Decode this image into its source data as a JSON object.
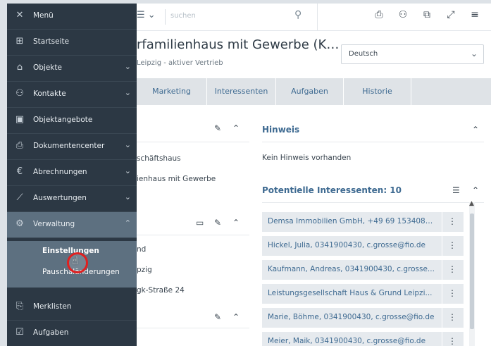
{
  "topbar": {
    "view_icon": "list-icon",
    "search_placeholder": "suchen",
    "icons": [
      "bookmark-icon",
      "user-icon",
      "copy-icon",
      "expand-icon",
      "menu-icon"
    ]
  },
  "header": {
    "title": "rfamilienhaus mit Gewerbe (K…",
    "subtitle": "Leipzig - aktiver Vertrieb",
    "language": "Deutsch"
  },
  "tabs": [
    "Marketing",
    "Interessenten",
    "Aufgaben",
    "Historie"
  ],
  "left_panel": {
    "lines_1": [
      "schäftshaus",
      "ienhaus mit Gewerbe"
    ],
    "lines_2": [
      "nd",
      "pzig",
      "gk-Straße 24"
    ]
  },
  "hint": {
    "heading": "Hinweis",
    "text": "Kein Hinweis vorhanden"
  },
  "prospects": {
    "heading": "Potentielle Interessenten: 10",
    "items": [
      "Demsa Immobilien GmbH, +49 69 1534080...",
      "Hickel, Julia, 0341900430, c.grosse@fio.de",
      "Kaufmann, Andreas, 0341900430, c.grosse...",
      "Leistungsgesellschaft Haus & Grund Leipzi...",
      "Marie, Böhme, 0341900430, c.grosse@fio.de",
      "Meier, Maik, 0341900430, c.grosse@fio.de"
    ]
  },
  "sidebar": {
    "header": "Menü",
    "items": [
      {
        "label": "Startseite",
        "icon": "grid-icon",
        "chevron": false
      },
      {
        "label": "Objekte",
        "icon": "home-icon",
        "chevron": true
      },
      {
        "label": "Kontakte",
        "icon": "user-icon",
        "chevron": true
      },
      {
        "label": "Objektangebote",
        "icon": "offer-icon",
        "chevron": false
      },
      {
        "label": "Dokumentencenter",
        "icon": "printer-icon",
        "chevron": true
      },
      {
        "label": "Abrechnungen",
        "icon": "euro-icon",
        "chevron": true
      },
      {
        "label": "Auswertungen",
        "icon": "chart-icon",
        "chevron": true
      },
      {
        "label": "Verwaltung",
        "icon": "gear-icon",
        "chevron": true,
        "expanded": true
      },
      {
        "label": "Merklisten",
        "icon": "bookmark-icon",
        "chevron": false
      },
      {
        "label": "Aufgaben",
        "icon": "tasks-icon",
        "chevron": false
      }
    ],
    "sub_items": [
      "Einstellungen",
      "Pauschaländerungen"
    ]
  },
  "colors": {
    "sidebar_bg": "#2c3844",
    "sidebar_active": "#5d7080",
    "accent": "#3e6a91",
    "highlight_ring": "#e02020"
  }
}
